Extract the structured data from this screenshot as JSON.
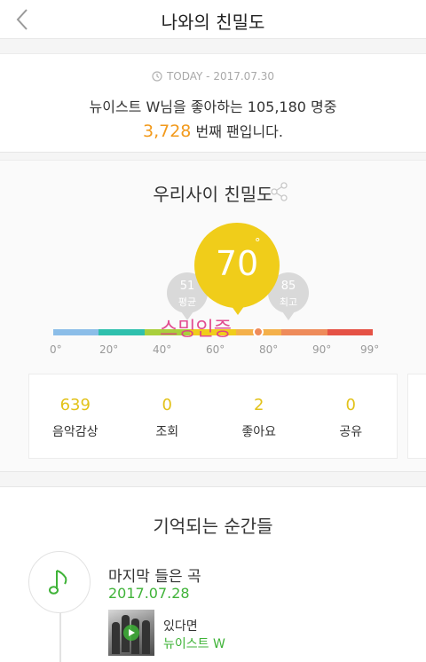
{
  "header": {
    "title": "나와의 친밀도",
    "back_icon": "chevron-left-icon"
  },
  "today": {
    "date_text": "TODAY - 2017.07.30",
    "summary": "뉴이스트 W님을 좋아하는 105,180 명중",
    "rank_number": "3,728",
    "rank_suffix": "번째 팬입니다."
  },
  "intimacy": {
    "title": "우리사이 친밀도",
    "score": "70",
    "degree": "°",
    "average": {
      "value": "51",
      "label": "평균"
    },
    "highest": {
      "value": "85",
      "label": "최고"
    },
    "watermark": "스밍인증",
    "scale_ticks": [
      "0°",
      "20°",
      "40°",
      "60°",
      "80°",
      "90°",
      "99°"
    ],
    "scale_colors": [
      "#8bbde8",
      "#2fc0ad",
      "#a9cf3c",
      "#f0cd1a",
      "#f4b04a",
      "#ee8b5a",
      "#e55245"
    ],
    "highest_marker_value": 85,
    "stats": [
      {
        "value": "639",
        "label": "음악감상"
      },
      {
        "value": "0",
        "label": "조회"
      },
      {
        "value": "2",
        "label": "좋아요"
      },
      {
        "value": "0",
        "label": "공유"
      }
    ]
  },
  "moments": {
    "title": "기억되는 순간들",
    "item": {
      "label": "마지막 들은 곡",
      "date": "2017.07.28",
      "song_title": "있다면",
      "artist": "뉴이스트 W"
    }
  }
}
